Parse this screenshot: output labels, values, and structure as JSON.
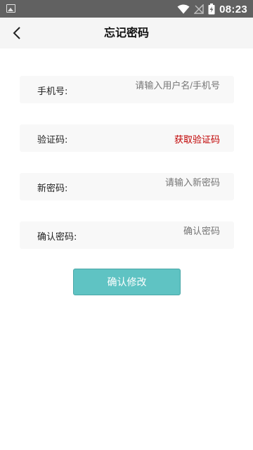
{
  "status_bar": {
    "time": "08:23",
    "icons": [
      "image-icon",
      "wifi-icon",
      "no-signal-icon",
      "battery-charging-icon"
    ]
  },
  "header": {
    "title": "忘记密码",
    "back_icon": "chevron-left-icon"
  },
  "form": {
    "phone": {
      "label": "手机号:",
      "placeholder": "请输入用户名/手机号"
    },
    "code": {
      "label": "验证码:",
      "action_label": "获取验证码"
    },
    "new_password": {
      "label": "新密码:",
      "placeholder": "请输入新密码"
    },
    "confirm_password": {
      "label": "确认密码:",
      "placeholder": "确认密码"
    },
    "submit_label": "确认修改"
  },
  "colors": {
    "accent": "#5fc3c3",
    "code_action": "#c00000",
    "status_bar": "#616161"
  }
}
